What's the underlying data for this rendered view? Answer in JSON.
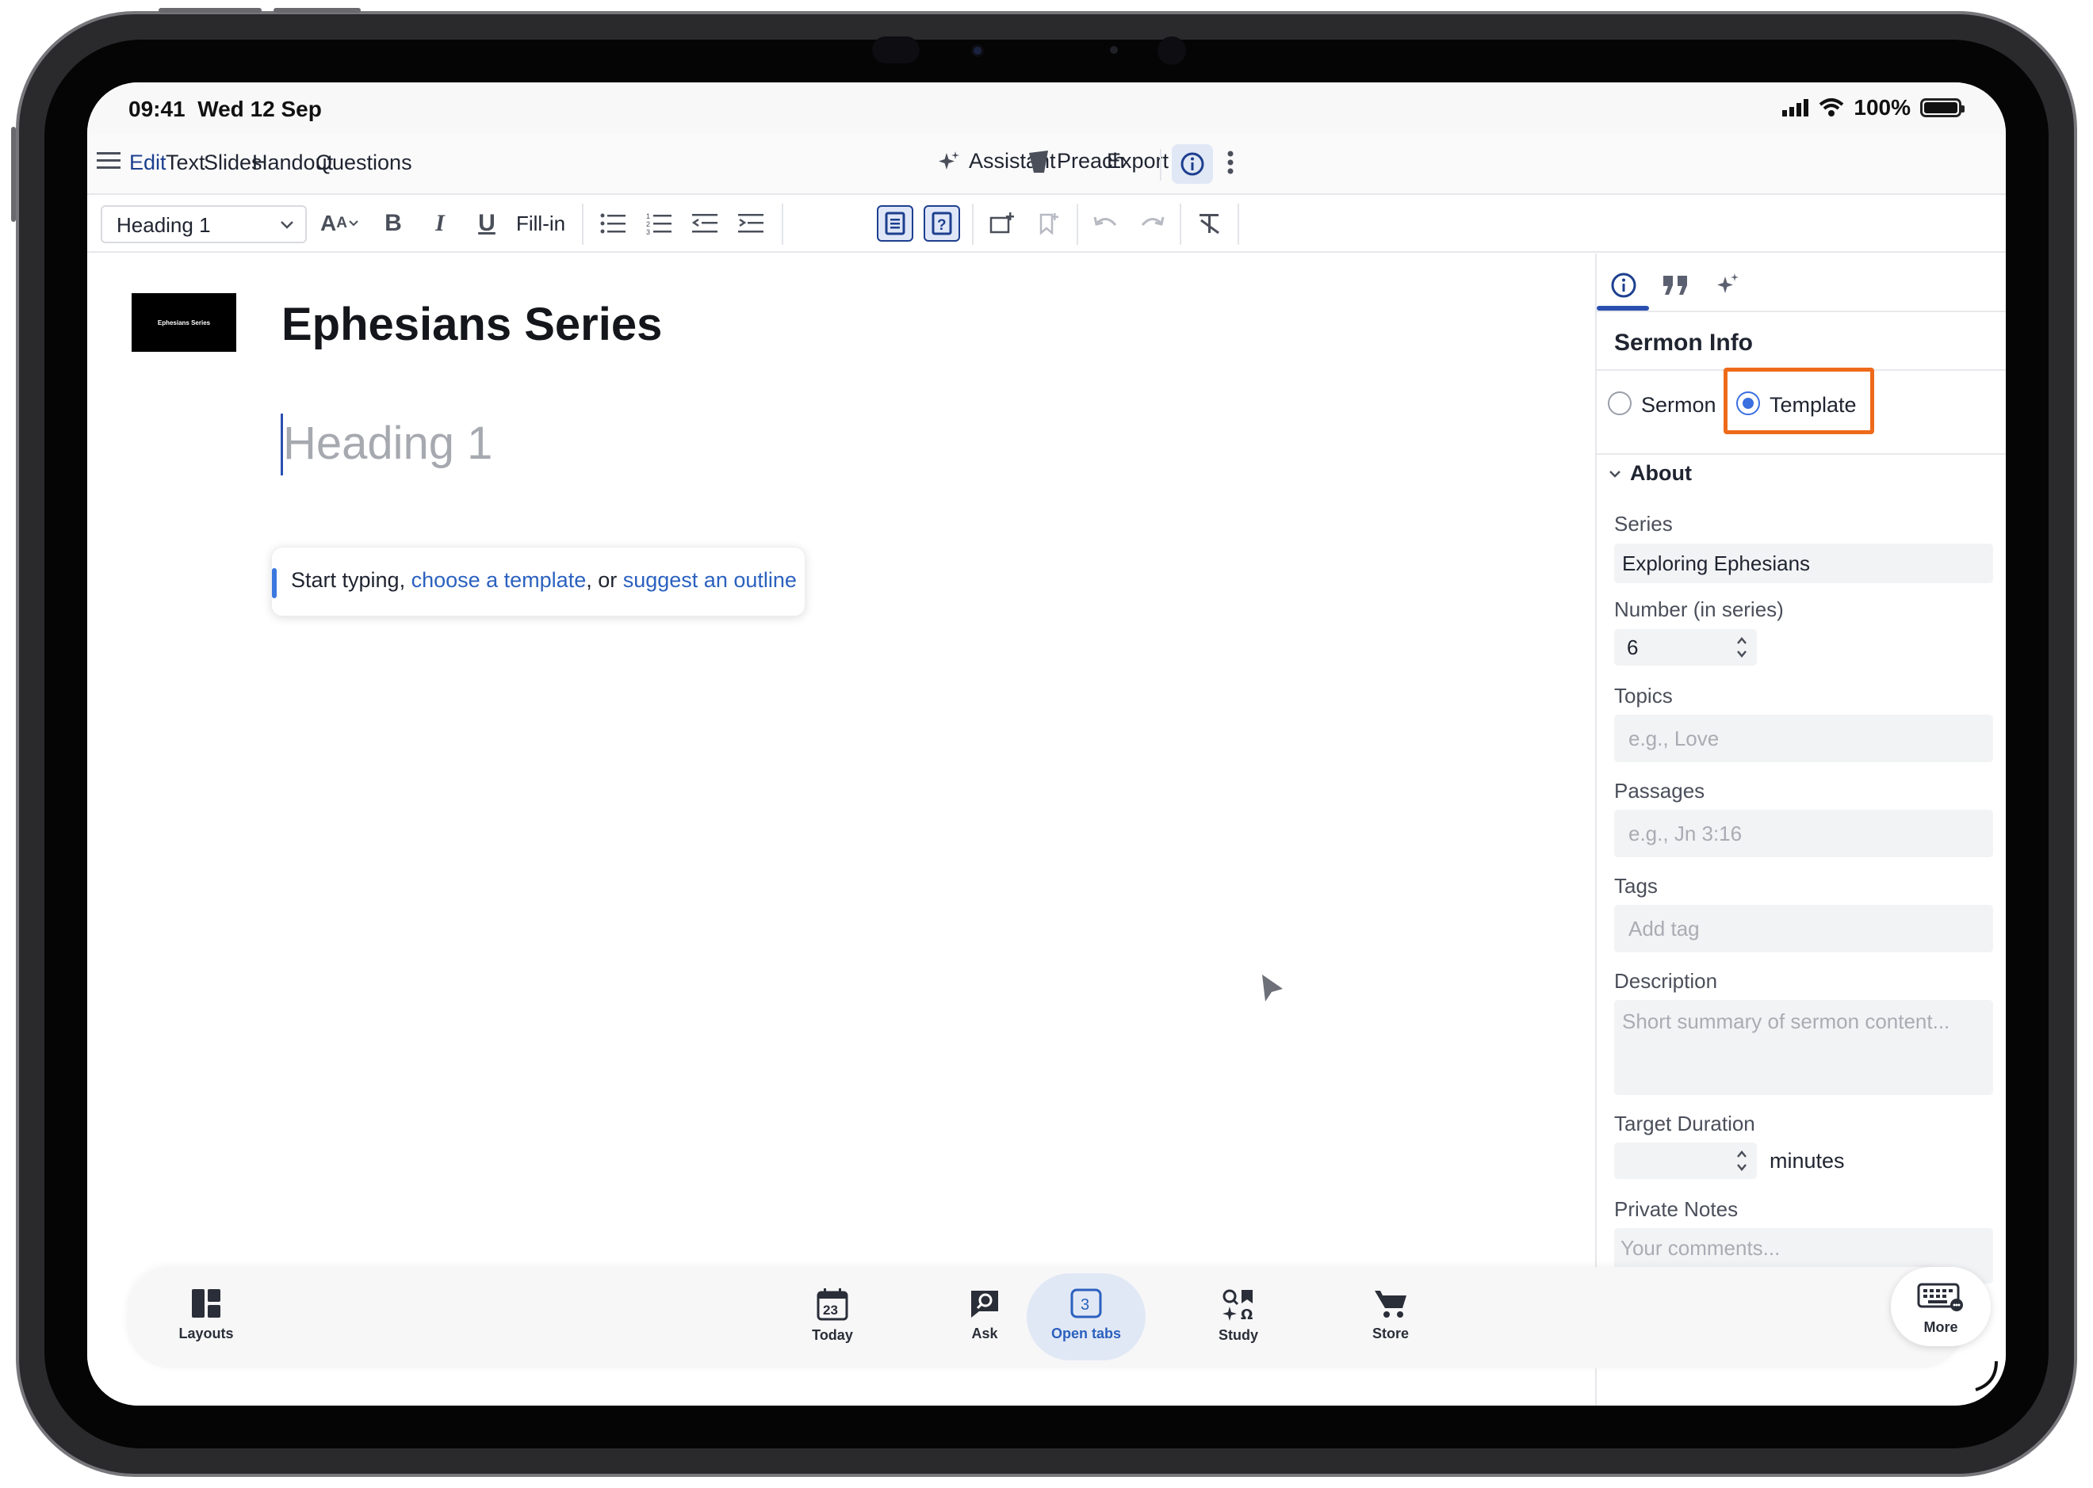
{
  "status_bar": {
    "time": "09:41",
    "date": "Wed 12 Sep",
    "battery": "100%"
  },
  "menu": {
    "tabs": [
      {
        "label": "Edit",
        "active": true
      },
      {
        "label": "Text"
      },
      {
        "label": "Slides"
      },
      {
        "label": "Handout"
      },
      {
        "label": "Questions"
      }
    ],
    "assistant_label": "Assistant",
    "preach_label": "Preach",
    "export_label": "Export"
  },
  "toolbar": {
    "paragraph_style": "Heading 1",
    "fill_in_label": "Fill-in"
  },
  "editor": {
    "thumbnail_text": "Ephesians Series",
    "title": "Ephesians Series",
    "heading_placeholder": "Heading 1",
    "hint": {
      "prefix": "Start typing, ",
      "link1": "choose a template",
      "middle": ", or ",
      "link2": "suggest an outline"
    }
  },
  "panel": {
    "title": "Sermon Info",
    "radio_options": [
      {
        "label": "Sermon",
        "checked": false
      },
      {
        "label": "Template",
        "checked": true
      }
    ],
    "about_label": "About",
    "fields": {
      "series_label": "Series",
      "series_value": "Exploring Ephesians",
      "number_label": "Number (in series)",
      "number_value": "6",
      "topics_label": "Topics",
      "topics_placeholder": "e.g., Love",
      "passages_label": "Passages",
      "passages_placeholder": "e.g., Jn 3:16",
      "tags_label": "Tags",
      "tags_placeholder": "Add tag",
      "description_label": "Description",
      "description_placeholder": "Short summary of sermon content...",
      "duration_label": "Target Duration",
      "duration_unit": "minutes",
      "notes_label": "Private Notes",
      "notes_placeholder": "Your comments..."
    }
  },
  "bottom_bar": {
    "items": [
      {
        "label": "Layouts",
        "icon": "layouts-icon"
      },
      {
        "label": "Today",
        "icon": "calendar-icon",
        "badge": "23"
      },
      {
        "label": "Ask",
        "icon": "ask-icon"
      },
      {
        "label": "Open tabs",
        "icon": "tabs-icon",
        "badge": "3",
        "active": true
      },
      {
        "label": "Study",
        "icon": "study-icon"
      },
      {
        "label": "Store",
        "icon": "cart-icon"
      },
      {
        "label": "More",
        "icon": "keyboard-icon"
      }
    ]
  },
  "colors": {
    "accent": "#2a4fb0",
    "link": "#2b61bf",
    "highlight": "#ee6a1a"
  }
}
